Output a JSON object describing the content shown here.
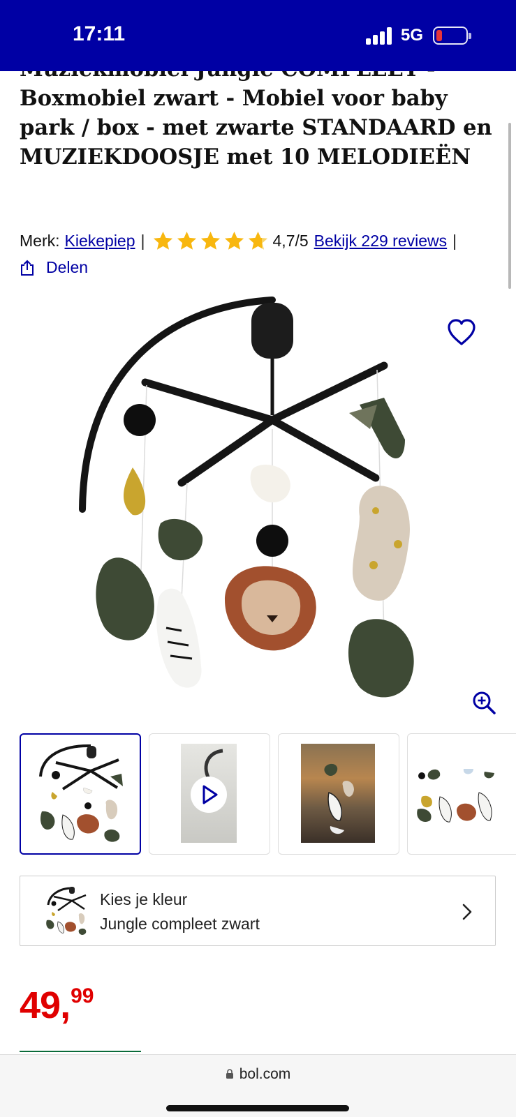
{
  "status_bar": {
    "time": "17:11",
    "network": "5G",
    "battery_color": "#ff3b30"
  },
  "product": {
    "title": "Muziekmobiel Jungle COMPLEET - Boxmobiel zwart - Mobiel voor baby park / box - met zwarte STANDAARD en MUZIEKDOOSJE met 10 MELODIEËN",
    "brand_label": "Merk:",
    "brand": "Kiekepiep",
    "rating": "4,7/5",
    "rating_value": 4.7,
    "rating_max": 5,
    "reviews_link": "Bekijk 229 reviews",
    "share_label": "Delen"
  },
  "icons": {
    "favorite": "heart-icon",
    "zoom": "zoom-in-icon",
    "share": "share-icon",
    "play": "play-icon",
    "chevron": "chevron-right-icon",
    "lock": "lock-icon"
  },
  "color_selector": {
    "label": "Kies je kleur",
    "value": "Jungle compleet zwart"
  },
  "price": {
    "main": "49,",
    "cents": "99"
  },
  "browser": {
    "url": "bol.com"
  },
  "colors": {
    "brand_blue": "#0000a4",
    "price_red": "#e00000",
    "star_yellow": "#f8b70f"
  }
}
